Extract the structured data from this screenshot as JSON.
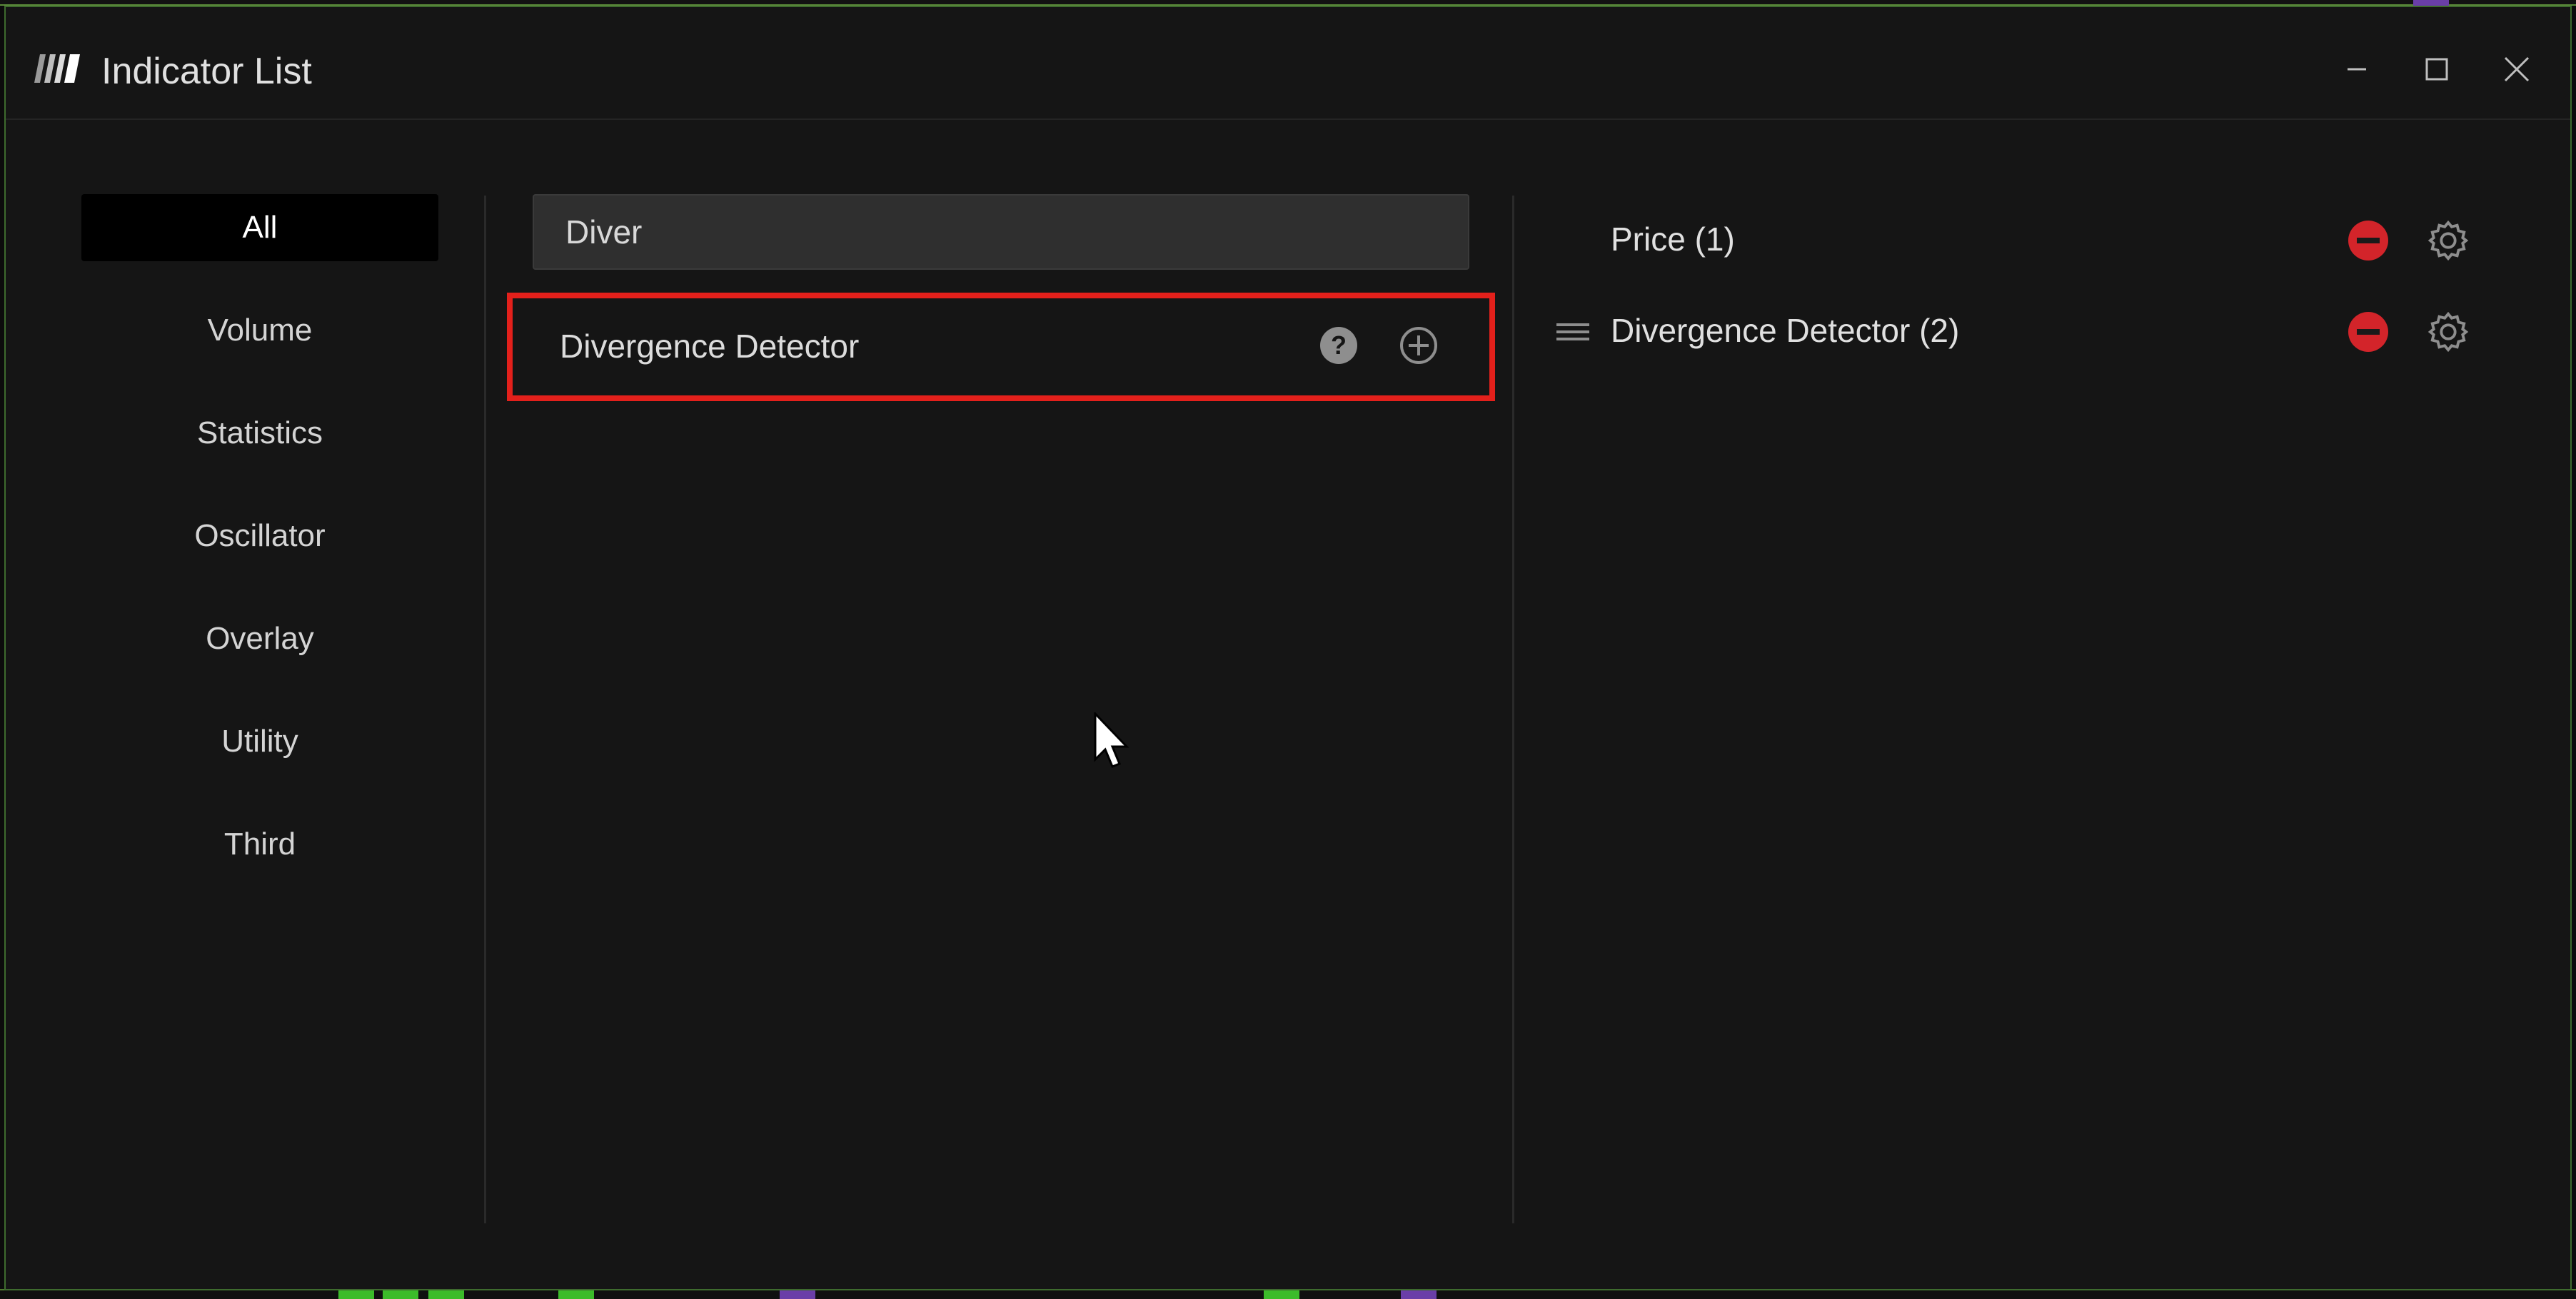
{
  "window": {
    "title": "Indicator List",
    "controls": [
      "minimize-icon",
      "maximize-icon",
      "close-icon"
    ]
  },
  "sidebar": {
    "categories": [
      {
        "label": "All",
        "active": true
      },
      {
        "label": "Volume",
        "active": false
      },
      {
        "label": "Statistics",
        "active": false
      },
      {
        "label": "Oscillator",
        "active": false
      },
      {
        "label": "Overlay",
        "active": false
      },
      {
        "label": "Utility",
        "active": false
      },
      {
        "label": "Third",
        "active": false
      }
    ]
  },
  "search": {
    "value": "Diver"
  },
  "results": [
    {
      "label": "Divergence Detector",
      "icons": [
        "help-icon",
        "add-icon"
      ],
      "highlighted": true
    }
  ],
  "active_indicators": [
    {
      "label": "Price (1)",
      "icons": [
        "remove-icon",
        "settings-icon"
      ],
      "draggable": false
    },
    {
      "label": "Divergence Detector (2)",
      "icons": [
        "remove-icon",
        "settings-icon"
      ],
      "draggable": true
    }
  ],
  "colors": {
    "highlight_border": "#e3201b",
    "remove_red": "#d3242a",
    "window_border": "#3e6b2e",
    "background": "#151515"
  }
}
